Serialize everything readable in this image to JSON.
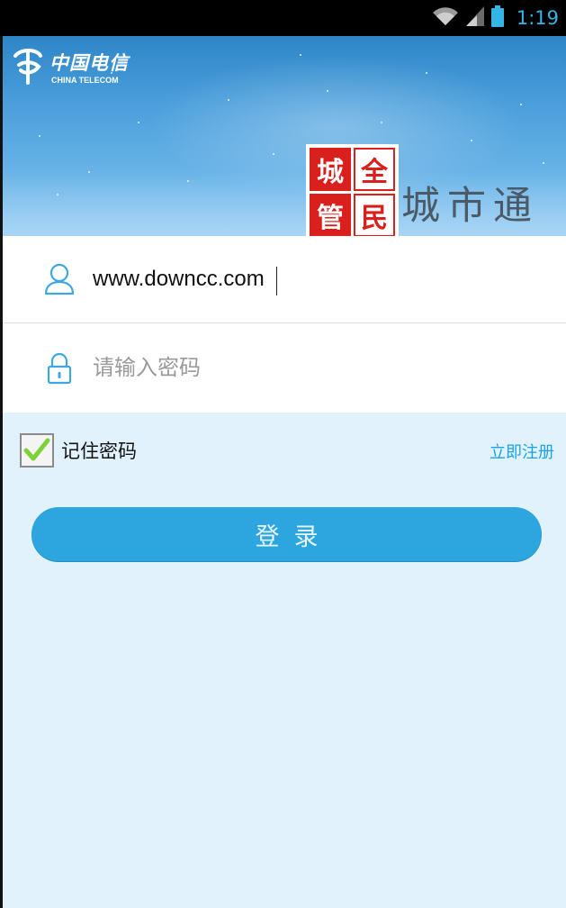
{
  "status_bar": {
    "time": "1:19",
    "icons": [
      "wifi-icon",
      "signal-icon",
      "battery-icon"
    ]
  },
  "banner": {
    "brand_cn": "中国电信",
    "brand_en": "CHINA TELECOM",
    "seal_chars": [
      "城",
      "全",
      "管",
      "民"
    ],
    "app_title": "城市通"
  },
  "form": {
    "username_value": "www.downcc.com",
    "password_placeholder": "请输入密码",
    "user_icon": "user-icon",
    "lock_icon": "lock-icon"
  },
  "remember": {
    "label": "记住密码",
    "checked": true
  },
  "register_label": "立即注册",
  "login_label": "登录",
  "colors": {
    "accent": "#2da6e0",
    "link": "#1aa3e0",
    "page_bg": "#e2f2fd",
    "seal_red": "#d9201c"
  }
}
